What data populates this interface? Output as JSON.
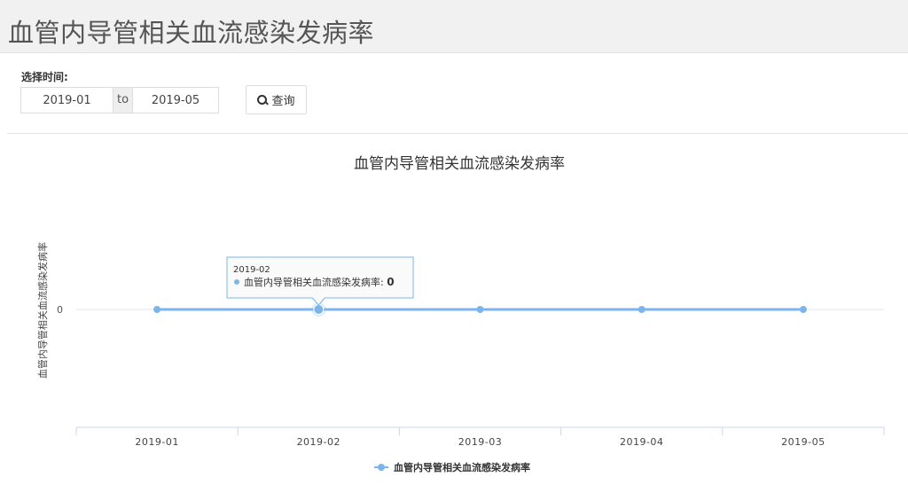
{
  "header": {
    "title": "血管内导管相关血流感染发病率"
  },
  "filter": {
    "label": "选择时间:",
    "start_value": "2019-01",
    "separator": "to",
    "end_value": "2019-05",
    "query_label": "查询"
  },
  "chart_data": {
    "type": "line",
    "title": "血管内导管相关血流感染发病率",
    "ylabel": "血管内导管相关血流感染发病率",
    "xlabel": "",
    "categories": [
      "2019-01",
      "2019-02",
      "2019-03",
      "2019-04",
      "2019-05"
    ],
    "series": [
      {
        "name": "血管内导管相关血流感染发病率",
        "values": [
          0,
          0,
          0,
          0,
          0
        ],
        "color": "#7cb5ec"
      }
    ],
    "y_ticks": [
      "0"
    ],
    "grid": true,
    "legend": "bottom-center",
    "tooltip": {
      "category": "2019-02",
      "series_name": "血管内导管相关血流感染发病率",
      "value_text": "0"
    }
  }
}
